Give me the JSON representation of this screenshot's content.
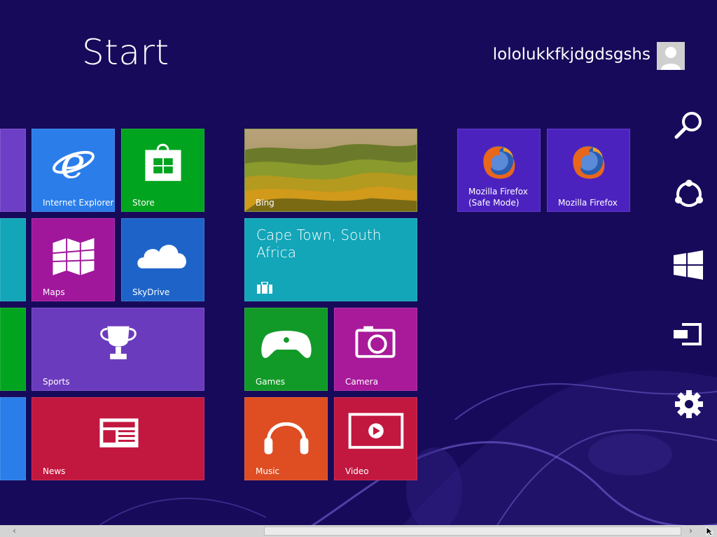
{
  "header": {
    "title": "Start",
    "user_name": "lololukkfkjdgdsgshs"
  },
  "tiles": {
    "internet_explorer": "Internet Explorer",
    "store": "Store",
    "maps": "Maps",
    "skydrive": "SkyDrive",
    "sports": "Sports",
    "news": "News",
    "bing": "Bing",
    "weather_location": "Cape Town, South Africa",
    "games": "Games",
    "camera": "Camera",
    "music": "Music",
    "video": "Video",
    "firefox_safe": "Mozilla Firefox (Safe Mode)",
    "firefox": "Mozilla Firefox"
  },
  "charms": [
    "search-icon",
    "share-icon",
    "start-icon",
    "devices-icon",
    "settings-icon"
  ],
  "colors": {
    "background": "#180a5a",
    "ie_blue": "#2b7de9",
    "store_green": "#00a41e",
    "maps_magenta": "#a0179c",
    "skydrive_blue": "#1e64c8",
    "sports_purple": "#6b3bbd",
    "news_red": "#c2173f",
    "weather_teal": "#13a5b8",
    "games_green": "#129a28",
    "camera_magenta": "#a81a9a",
    "music_orange": "#df4d22",
    "video_red": "#c2173f",
    "firefox_tile": "#4c22bf"
  }
}
